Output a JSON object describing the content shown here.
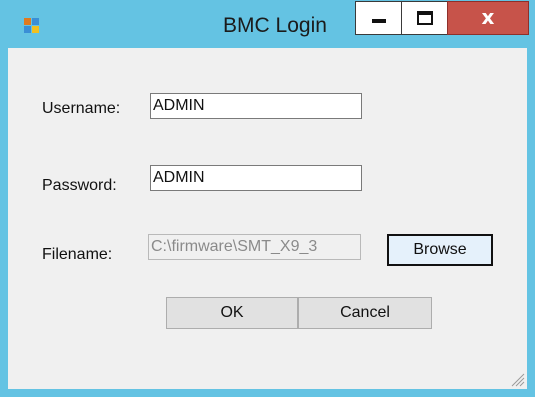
{
  "window": {
    "title": "BMC Login",
    "icon": "app-window-icon",
    "controls": {
      "minimize_icon": "minimize-icon",
      "maximize_icon": "maximize-icon",
      "close_glyph": "x"
    }
  },
  "form": {
    "username_label": "Username:",
    "username_value": "ADMIN",
    "password_label": "Password:",
    "password_value": "ADMIN",
    "filename_label": "Filename:",
    "filename_value": "C:\\firmware\\SMT_X9_3",
    "browse_label": "Browse",
    "ok_label": "OK",
    "cancel_label": "Cancel"
  },
  "colors": {
    "title_bar": "#64c3e3",
    "close_button": "#c7534a",
    "client_background": "#f0f0f0"
  }
}
